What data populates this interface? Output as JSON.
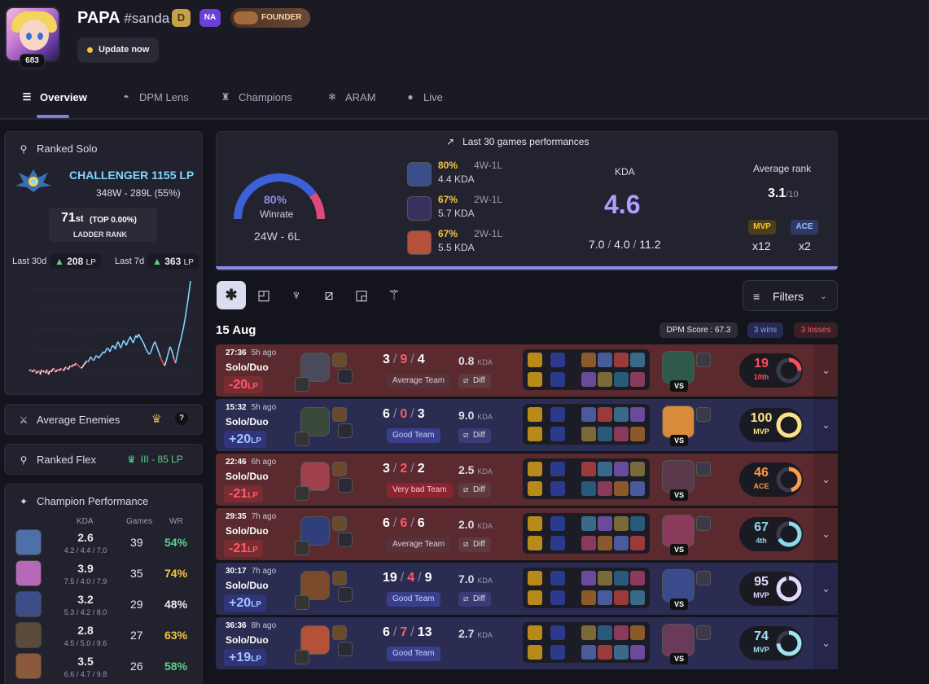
{
  "profile": {
    "name": "PAPA",
    "tag": "#sanda",
    "level": "683",
    "badge_d": "D",
    "region": "NA",
    "founder": "FOUNDER",
    "update_label": "Update now"
  },
  "tabs": [
    {
      "label": "Overview"
    },
    {
      "label": "DPM Lens"
    },
    {
      "label": "Champions"
    },
    {
      "label": "ARAM"
    },
    {
      "label": "Live"
    }
  ],
  "ranked_solo": {
    "title": "Ranked Solo",
    "tier": "CHALLENGER 1155 LP",
    "record": "348W - 289L (55%)",
    "ladder_pos": "71",
    "ladder_suffix": "st",
    "ladder_pct": "(TOP 0.00%)",
    "ladder_label": "LADDER RANK",
    "last30_label": "Last 30d",
    "last30_value": "208",
    "last7_label": "Last 7d",
    "last7_value": "363",
    "lp_unit": "LP"
  },
  "avg_enemies": {
    "title": "Average Enemies",
    "help": "?"
  },
  "ranked_flex": {
    "title": "Ranked Flex",
    "value": "III - 85 LP"
  },
  "champ_perf": {
    "title": "Champion Performance",
    "headers": [
      "KDA",
      "Games",
      "WR"
    ],
    "rows": [
      {
        "kda": "2.6",
        "detail": "4.2 / 4.4 / 7.0",
        "games": "39",
        "wr": "54%",
        "wrc": "#5ad28a",
        "color": "#4e6fa8"
      },
      {
        "kda": "3.9",
        "detail": "7.5 / 4.0 / 7.9",
        "games": "35",
        "wr": "74%",
        "wrc": "#f4c542",
        "color": "#b569b8"
      },
      {
        "kda": "3.2",
        "detail": "5.3 / 4.2 / 8.0",
        "games": "29",
        "wr": "48%",
        "wrc": "#e8e8f0",
        "color": "#3b4e8a"
      },
      {
        "kda": "2.8",
        "detail": "4.5 / 5.0 / 9.6",
        "games": "27",
        "wr": "63%",
        "wrc": "#f4c542",
        "color": "#5a4a3a"
      },
      {
        "kda": "3.5",
        "detail": "6.6 / 4.7 / 9.8",
        "games": "26",
        "wr": "58%",
        "wrc": "#5ad28a",
        "color": "#8a5a3a"
      }
    ]
  },
  "perf": {
    "title": "Last 30 games performances",
    "winrate": "80%",
    "winrate_label": "Winrate",
    "record": "24W - 6L",
    "winrate_value": 0.8,
    "champs": [
      {
        "pct": "80%",
        "wl": "4W-1L",
        "kda": "4.4 KDA",
        "color": "#3b4e8a"
      },
      {
        "pct": "67%",
        "wl": "2W-1L",
        "kda": "5.7 KDA",
        "color": "#3a3060"
      },
      {
        "pct": "67%",
        "wl": "2W-1L",
        "kda": "5.5 KDA",
        "color": "#b5503a"
      }
    ],
    "kda_label": "KDA",
    "kda": "4.6",
    "k": "7.0",
    "d": "4.0",
    "a": "11.2",
    "sep": "/",
    "avg_rank_label": "Average rank",
    "avg_rank": "3.1",
    "avg_rank_of": "/10",
    "mvp_label": "MVP",
    "mvp_count": "x12",
    "ace_label": "ACE",
    "ace_count": "x2"
  },
  "filters": {
    "label": "Filters"
  },
  "match_day": {
    "date": "15 Aug",
    "dpm": "DPM Score : 67.3",
    "wins": "3 wins",
    "losses": "3 losses"
  },
  "games": [
    {
      "result": "loss",
      "time": "27:36",
      "ago": "5h ago",
      "queue": "Solo/Duo",
      "lp": "-20",
      "k": "3",
      "d": "9",
      "a": "4",
      "kdav": "0.8",
      "team": "Average Team",
      "tcls": "avg",
      "diff": "Diff",
      "score": "19",
      "slab": "10th",
      "sval": 0.25,
      "scol": "#ff4d5a",
      "champ": "#4a4a5a",
      "opp": "#2e5a4a"
    },
    {
      "result": "win",
      "time": "15:32",
      "ago": "5h ago",
      "queue": "Solo/Duo",
      "lp": "+20",
      "k": "6",
      "d": "0",
      "a": "3",
      "kdav": "9.0",
      "team": "Good Team",
      "tcls": "good",
      "diff": "Diff",
      "score": "100",
      "slab": "MVP",
      "sval": 1,
      "scol": "#ffe08a",
      "champ": "#3a4a3a",
      "opp": "#d98a3a"
    },
    {
      "result": "loss",
      "time": "22:46",
      "ago": "6h ago",
      "queue": "Solo/Duo",
      "lp": "-21",
      "k": "3",
      "d": "2",
      "a": "2",
      "kdav": "2.5",
      "team": "Very bad Team",
      "tcls": "bad",
      "diff": "Diff",
      "score": "46",
      "slab": "ACE",
      "sval": 0.46,
      "scol": "#ff9a4a",
      "champ": "#a0404a",
      "opp": "#5a3a4a"
    },
    {
      "result": "loss",
      "time": "29:35",
      "ago": "7h ago",
      "queue": "Solo/Duo",
      "lp": "-21",
      "k": "6",
      "d": "6",
      "a": "6",
      "kdav": "2.0",
      "team": "Average Team",
      "tcls": "avg",
      "diff": "Diff",
      "score": "67",
      "slab": "4th",
      "sval": 0.67,
      "scol": "#8fd8e8",
      "champ": "#2f3f7a",
      "opp": "#8a3a5a"
    },
    {
      "result": "win",
      "time": "30:17",
      "ago": "7h ago",
      "queue": "Solo/Duo",
      "lp": "+20",
      "k": "19",
      "d": "4",
      "a": "9",
      "kdav": "7.0",
      "team": "Good Team",
      "tcls": "good",
      "diff": "Diff",
      "score": "95",
      "slab": "MVP",
      "sval": 0.95,
      "scol": "#e4d8ff",
      "champ": "#7a4a2a",
      "opp": "#3a4a8a"
    },
    {
      "result": "win",
      "time": "36:36",
      "ago": "8h ago",
      "queue": "Solo/Duo",
      "lp": "+19",
      "k": "6",
      "d": "7",
      "a": "13",
      "kdav": "2.7",
      "team": "Good Team",
      "tcls": "good",
      "diff": "",
      "score": "74",
      "slab": "MVP",
      "sval": 0.74,
      "scol": "#9fe4f0",
      "champ": "#b5503a",
      "opp": "#6a3a5a"
    }
  ],
  "lp_history": [
    -3,
    -2,
    -4,
    -3,
    -2,
    -5,
    -4,
    -3,
    -6,
    -2,
    -4,
    -3,
    -5,
    -2,
    -6,
    -3,
    -4,
    -2,
    -1,
    -4,
    -3,
    -2,
    -3,
    -1,
    -2,
    -3,
    -1,
    0,
    -2,
    -1,
    1,
    0,
    2,
    1,
    3,
    2,
    1,
    0,
    -1,
    0,
    2,
    3,
    5,
    4,
    6,
    8,
    6,
    5,
    7,
    9,
    8,
    7,
    9,
    10,
    12,
    11,
    13,
    15,
    14,
    12,
    15,
    17,
    16,
    14,
    18,
    20,
    17,
    15,
    18,
    21,
    19,
    17,
    20,
    22,
    24,
    21,
    19,
    22,
    25,
    23,
    26,
    24,
    22,
    20,
    18,
    15,
    13,
    11,
    10,
    12,
    15,
    18,
    20,
    17,
    14,
    11,
    8,
    5,
    3,
    1,
    4,
    8,
    12,
    16,
    14,
    10,
    6,
    3,
    8,
    13,
    18,
    22,
    27,
    32,
    38,
    45,
    52,
    60,
    68
  ]
}
